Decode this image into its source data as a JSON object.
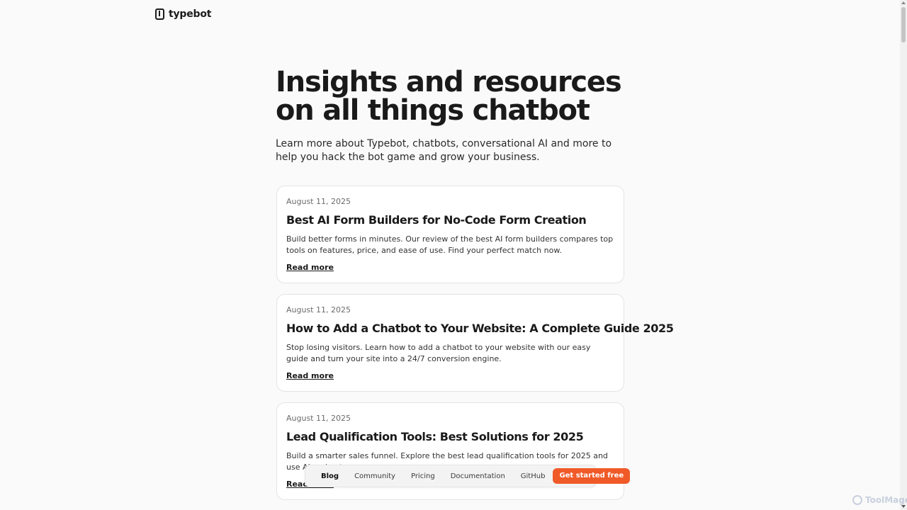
{
  "brand": {
    "name": "typebot",
    "logo_icon": "typebot-logo-icon"
  },
  "hero": {
    "title": "Insights and resources on all things chatbot",
    "subtitle": "Learn more about Typebot, chatbots, conversational AI and more to help you hack the bot game and grow your business."
  },
  "posts": [
    {
      "date": "August 11, 2025",
      "title": "Best AI Form Builders for No-Code Form Creation",
      "description": "Build better forms in minutes. Our review of the best AI form builders compares top tools on features, price, and ease of use. Find your perfect match now.",
      "link": "Read more"
    },
    {
      "date": "August 11, 2025",
      "title": "How to Add a Chatbot to Your Website: A Complete Guide 2025",
      "description": "Stop losing visitors. Learn how to add a chatbot to your website with our easy guide and turn your site into a 24/7 conversion engine.",
      "link": "Read more"
    },
    {
      "date": "August 11, 2025",
      "title": "Lead Qualification Tools: Best Solutions for 2025",
      "description": "Build a smarter sales funnel. Explore the best lead qualification tools for 2025 and use AI and autor",
      "link": "Read more"
    }
  ],
  "nav": {
    "items": [
      "Blog",
      "Community",
      "Pricing",
      "Documentation",
      "GitHub"
    ],
    "active": "Blog",
    "cta": "Get started free",
    "cta_color": "#f05a28"
  },
  "watermark": {
    "text": "ToolMage"
  }
}
